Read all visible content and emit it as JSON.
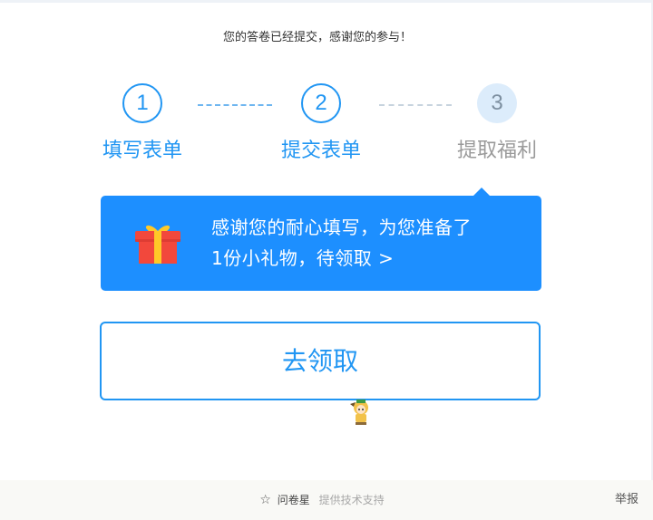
{
  "header": {
    "message": "您的答卷已经提交，感谢您的参与！"
  },
  "steps": [
    {
      "number": "1",
      "label": "填写表单",
      "state": "done"
    },
    {
      "number": "2",
      "label": "提交表单",
      "state": "done"
    },
    {
      "number": "3",
      "label": "提取福利",
      "state": "current"
    }
  ],
  "gift": {
    "line1": "感谢您的耐心填写，为您准备了",
    "line2": "1份小礼物，待领取 >",
    "icon": "gift-icon"
  },
  "claim_button": {
    "label": "去领取"
  },
  "footer": {
    "star_icon": "☆",
    "brand": "问卷星",
    "support": "提供技术支持",
    "report": "举报"
  },
  "colors": {
    "accent": "#2196f3",
    "card_bg": "#1d8fff",
    "inactive_step": "#dcecfb",
    "gift_red": "#f2483c",
    "gift_ribbon": "#ffc928"
  }
}
